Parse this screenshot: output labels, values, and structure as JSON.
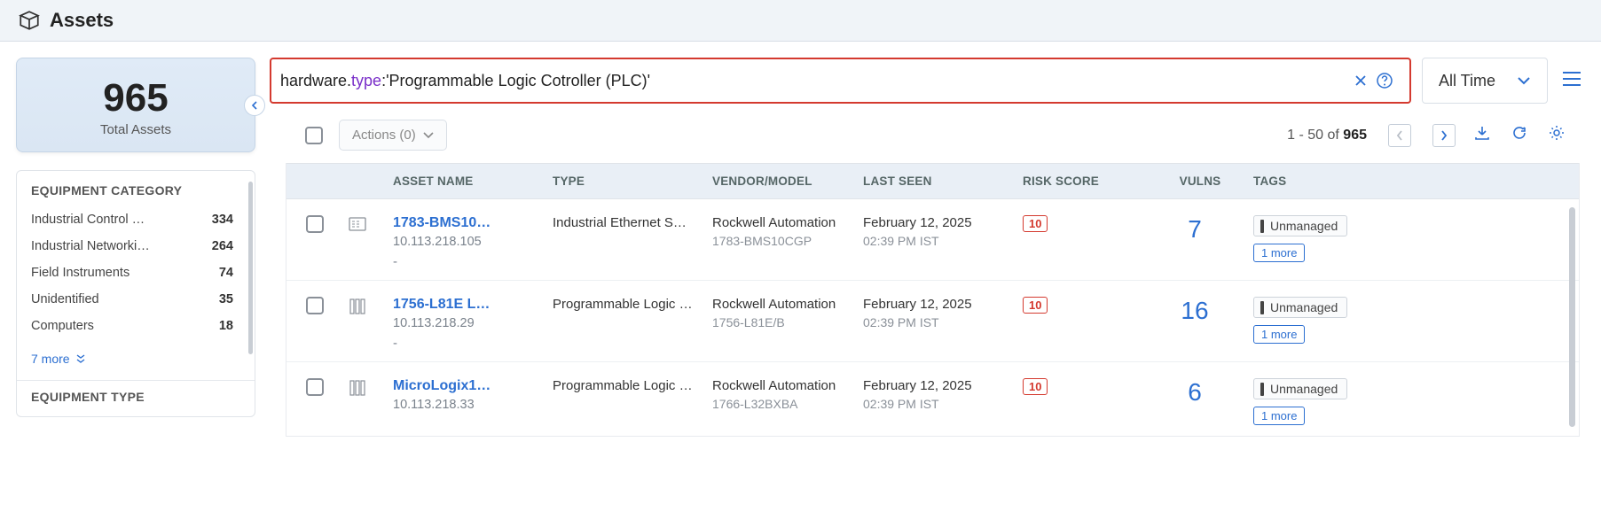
{
  "page": {
    "title": "Assets"
  },
  "totals": {
    "count": "965",
    "label": "Total Assets"
  },
  "search": {
    "query_prefix": "hardware.",
    "query_key": "type",
    "query_value": ":'Programmable Logic Cotroller (PLC)'"
  },
  "time_filter": {
    "label": "All Time"
  },
  "facets": [
    {
      "title": "EQUIPMENT CATEGORY",
      "items": [
        {
          "name": "Industrial Control …",
          "count": "334"
        },
        {
          "name": "Industrial Networki…",
          "count": "264"
        },
        {
          "name": "Field Instruments",
          "count": "74"
        },
        {
          "name": "Unidentified",
          "count": "35"
        },
        {
          "name": "Computers",
          "count": "18"
        }
      ],
      "more": "7 more"
    },
    {
      "title": "EQUIPMENT TYPE"
    }
  ],
  "toolbar": {
    "actions_label": "Actions (0)",
    "range": "1 - 50 of ",
    "total": "965"
  },
  "columns": {
    "name": "ASSET NAME",
    "type": "TYPE",
    "vendor": "VENDOR/MODEL",
    "seen": "LAST SEEN",
    "risk": "RISK SCORE",
    "vulns": "VULNS",
    "tags": "TAGS"
  },
  "rows": [
    {
      "icon": "switch",
      "name": "1783-BMS10…",
      "ip": "10.113.218.105",
      "type": "Industrial Ethernet S…",
      "vendor": "Rockwell Automation",
      "model": "1783-BMS10CGP",
      "seen_date": "February 12, 2025",
      "seen_time": "02:39 PM IST",
      "risk": "10",
      "vulns": "7",
      "tag": "Unmanaged",
      "tag_more": "1 more"
    },
    {
      "icon": "rack",
      "name": "1756-L81E L…",
      "ip": "10.113.218.29",
      "type": "Programmable Logic …",
      "vendor": "Rockwell Automation",
      "model": "1756-L81E/B",
      "seen_date": "February 12, 2025",
      "seen_time": "02:39 PM IST",
      "risk": "10",
      "vulns": "16",
      "tag": "Unmanaged",
      "tag_more": "1 more"
    },
    {
      "icon": "rack",
      "name": "MicroLogix1…",
      "ip": "10.113.218.33",
      "type": "Programmable Logic …",
      "vendor": "Rockwell Automation",
      "model": "1766-L32BXBA",
      "seen_date": "February 12, 2025",
      "seen_time": "02:39 PM IST",
      "risk": "10",
      "vulns": "6",
      "tag": "Unmanaged",
      "tag_more": "1 more"
    }
  ]
}
